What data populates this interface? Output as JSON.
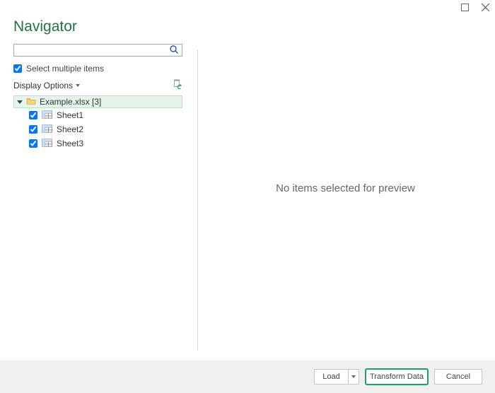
{
  "titlebar": {},
  "heading": "Navigator",
  "search": {
    "placeholder": ""
  },
  "multi_select_label": "Select multiple items",
  "display_options_label": "Display Options",
  "tree": {
    "file_label": "Example.xlsx [3]",
    "sheets": [
      {
        "label": "Sheet1"
      },
      {
        "label": "Sheet2"
      },
      {
        "label": "Sheet3"
      }
    ]
  },
  "preview_message": "No items selected for preview",
  "footer": {
    "load_label": "Load",
    "transform_label": "Transform Data",
    "cancel_label": "Cancel"
  }
}
